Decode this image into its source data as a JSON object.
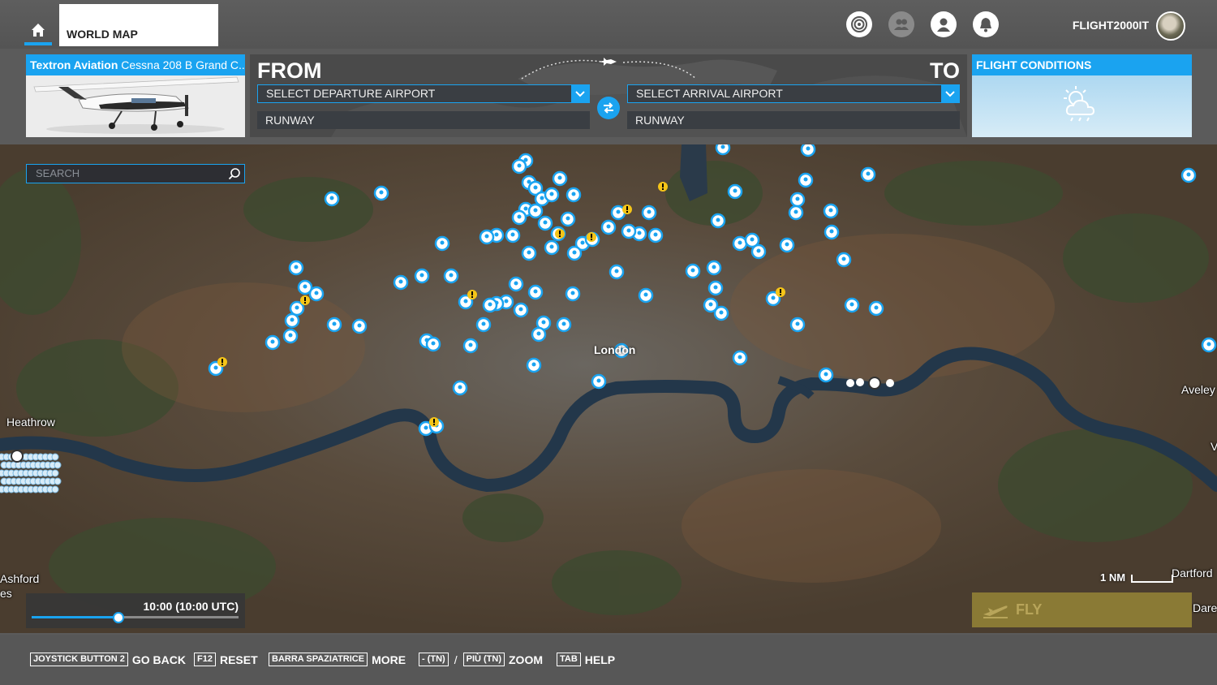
{
  "nav": {
    "active_tab": "WORLD MAP",
    "username": "FLIGHT2000IT"
  },
  "aircraft": {
    "brand": "Textron Aviation",
    "model": "Cessna 208 B Grand C..."
  },
  "route": {
    "from_label": "FROM",
    "to_label": "TO",
    "departure_placeholder": "SELECT DEPARTURE AIRPORT",
    "arrival_placeholder": "SELECT ARRIVAL AIRPORT",
    "departure_runway": "RUNWAY",
    "arrival_runway": "RUNWAY"
  },
  "conditions": {
    "title": "FLIGHT CONDITIONS",
    "weather_icon": "partly-cloudy-icon"
  },
  "map": {
    "search_placeholder": "SEARCH",
    "labels": {
      "heathrow": "Heathrow",
      "london": "London",
      "aveley": "Aveley",
      "ashford": "Ashford",
      "es": "es",
      "dartford": "Dartford",
      "dare": "Dare",
      "v": "V"
    },
    "time": "10:00 (10:00 UTC)",
    "time_of_day_fraction": 0.42,
    "scale_label": "1 NM",
    "fly_label": "FLY"
  },
  "hints": [
    {
      "key": "JOYSTICK BUTTON 2",
      "label": "GO BACK"
    },
    {
      "key": "F12",
      "label": "RESET"
    },
    {
      "key": "BARRA SPAZIATRICE",
      "label": "MORE"
    },
    {
      "key": "- (TN)",
      "key2": "PIÙ (TN)",
      "separator": "/",
      "label": "ZOOM"
    },
    {
      "key": "TAB",
      "label": "HELP"
    }
  ],
  "colors": {
    "accent": "#1aa3f0",
    "fly_disabled": "#8a7a35",
    "warning": "#f5c518"
  }
}
